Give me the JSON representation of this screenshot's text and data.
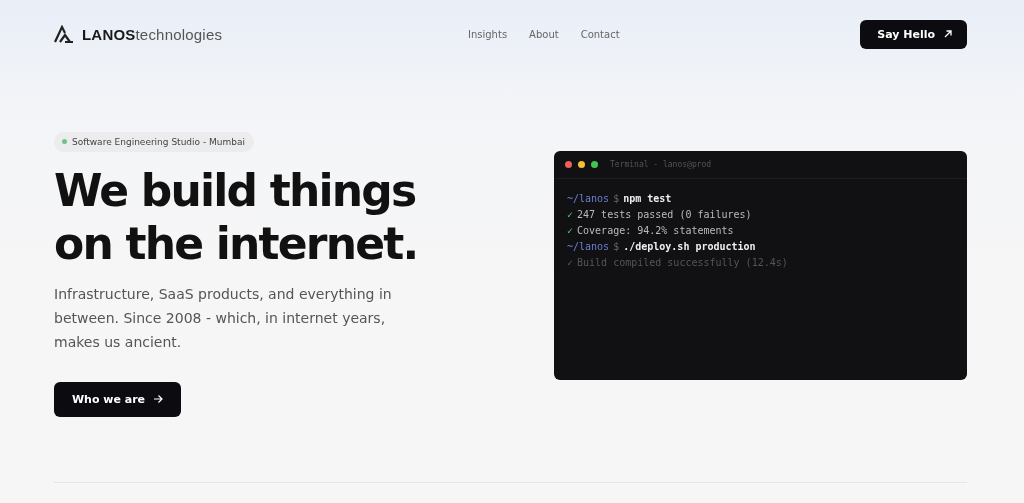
{
  "header": {
    "logo": "**LANOS**technologies",
    "nav": [
      {
        "label": "Insights"
      },
      {
        "label": "About"
      },
      {
        "label": "Contact"
      }
    ],
    "cta": "Say Hello"
  },
  "hero": {
    "badge": {
      "text": "Software Engineering Studio - Mumbai",
      "color": "#6cc38a"
    },
    "heading": [
      "We build things",
      "on the internet."
    ],
    "text": "Infrastructure, SaaS products, and everything in between. Since 2008 - which, in internet years, makes us ancient.",
    "button": "Who we are"
  },
  "terminal": {
    "title": "Terminal - lanos@prod",
    "lines": [
      {
        "kind": "command",
        "prompt": "~/lanos",
        "symbol": "$",
        "text": "npm test"
      },
      {
        "kind": "output",
        "mark": "✓",
        "text": "247 tests passed (0 failures)",
        "dimmed": false
      },
      {
        "kind": "output",
        "mark": "✓",
        "text": "Coverage: 94.2% statements",
        "dimmed": false
      },
      {
        "kind": "command",
        "prompt": "~/lanos",
        "symbol": "$",
        "text": "./deploy.sh production"
      },
      {
        "kind": "output",
        "mark": "✓",
        "text": "Build compiled successfully (12.4s)",
        "dimmed": true
      }
    ]
  }
}
